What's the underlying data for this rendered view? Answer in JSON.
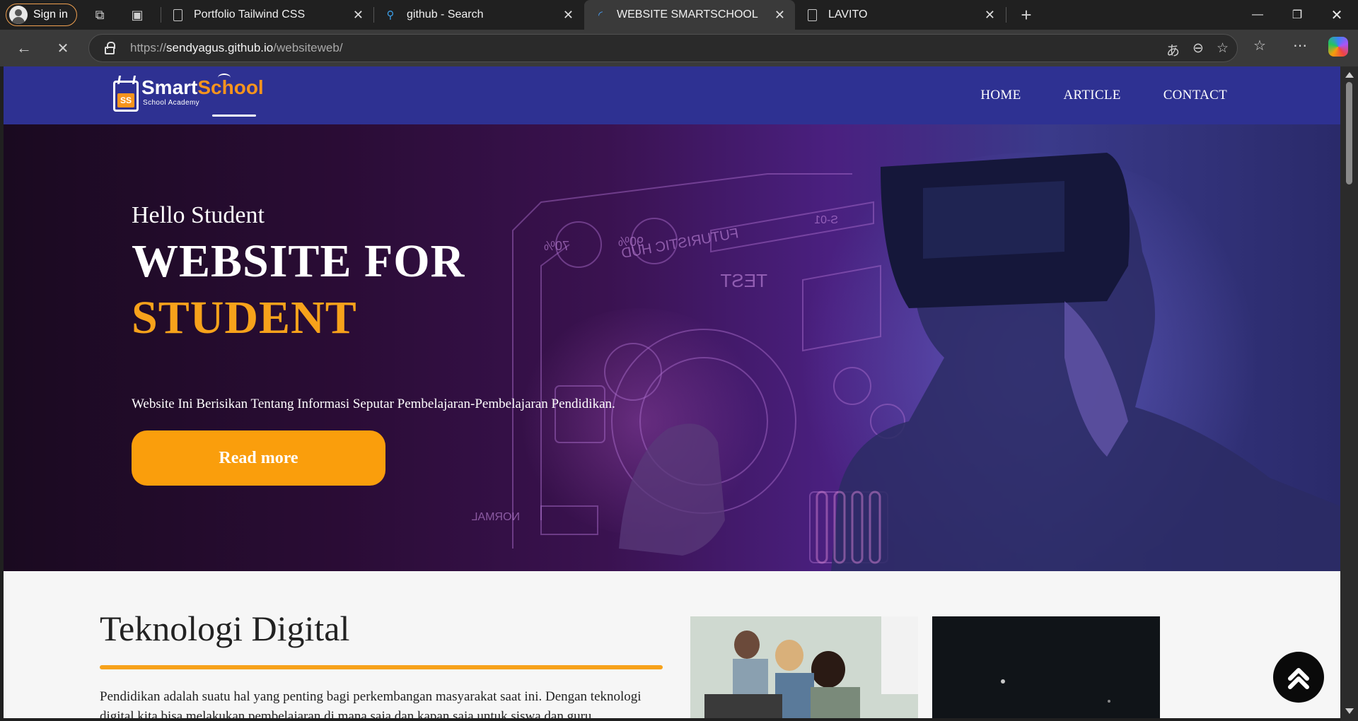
{
  "browser": {
    "signin_label": "Sign in",
    "tabs": [
      {
        "title": "Portfolio Tailwind CSS"
      },
      {
        "title": "github - Search"
      },
      {
        "title": "WEBSITE SMARTSCHOOL"
      },
      {
        "title": "LAVITO"
      }
    ],
    "url_prefix": "https://",
    "url_host": "sendyagus.github.io",
    "url_path": "/websiteweb/"
  },
  "site": {
    "logo_word1": "Smart",
    "logo_word2": "School",
    "logo_sub": "School Academy",
    "logo_badge": "SS",
    "nav": [
      {
        "label": "HOME"
      },
      {
        "label": "ARTICLE"
      },
      {
        "label": "CONTACT"
      }
    ],
    "hero": {
      "greeting": "Hello Student",
      "title_line1": "WEBSITE FOR",
      "title_line2": "STUDENT",
      "description": "Website Ini Berisikan Tentang Informasi Seputar Pembelajaran-Pembelajaran Pendidikan.",
      "button_label": "Read more",
      "hud_texts": [
        "FUTURISTIC HUD",
        "TEST",
        "70%",
        "90%",
        "S-01",
        "NORMAL"
      ]
    },
    "section": {
      "title": "Teknologi Digital",
      "text": "Pendidikan adalah suatu hal yang penting bagi perkembangan masyarakat saat ini. Dengan teknologi digital kita bisa melakukan pembelajaran di mana saja dan kapan saja untuk siswa dan guru."
    }
  },
  "colors": {
    "navbar": "#2e3192",
    "accent": "#f7a21b",
    "button": "#fa9e0c"
  }
}
